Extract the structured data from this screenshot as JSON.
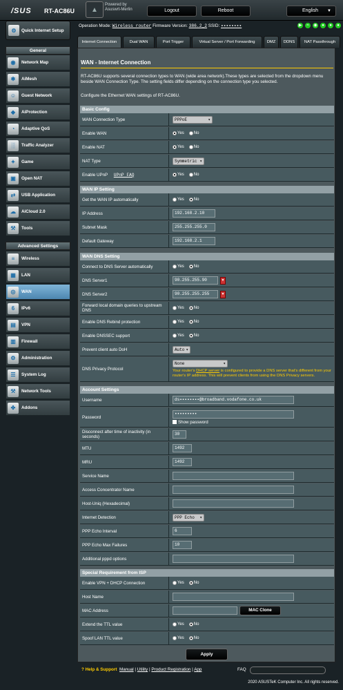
{
  "header": {
    "logo": "/SUS",
    "model": "RT-AC86U",
    "powered_by": "Powered by",
    "powered_name": "Asuswrt-Merlin",
    "logout": "Logout",
    "reboot": "Reboot",
    "language": "English"
  },
  "opbar": {
    "mode_label": "Operation Mode:",
    "mode_value": "Wireless router",
    "fw_label": "Firmware Version:",
    "fw_value": "386.2_2",
    "ssid_label": "SSID:",
    "ssid_value": "▪▪▪▪▪▪▪▪"
  },
  "sidebar": {
    "qis": "Quick Internet Setup",
    "general_header": "General",
    "general": [
      {
        "label": "Network Map",
        "icon": "network-map"
      },
      {
        "label": "AiMesh",
        "icon": "aimesh"
      },
      {
        "label": "Guest Network",
        "icon": "guest-network"
      },
      {
        "label": "AiProtection",
        "icon": "shield"
      },
      {
        "label": "Adaptive QoS",
        "icon": "qos-gauge"
      },
      {
        "label": "Traffic Analyzer",
        "icon": "traffic-chart"
      },
      {
        "label": "Game",
        "icon": "gamepad"
      },
      {
        "label": "Open NAT",
        "icon": "open-nat"
      },
      {
        "label": "USB Application",
        "icon": "usb"
      },
      {
        "label": "AiCloud 2.0",
        "icon": "cloud"
      },
      {
        "label": "Tools",
        "icon": "wrench"
      }
    ],
    "advanced_header": "Advanced Settings",
    "advanced": [
      {
        "label": "Wireless",
        "icon": "wifi"
      },
      {
        "label": "LAN",
        "icon": "lan"
      },
      {
        "label": "WAN",
        "icon": "globe"
      },
      {
        "label": "IPv6",
        "icon": "ipv6"
      },
      {
        "label": "VPN",
        "icon": "vpn"
      },
      {
        "label": "Firewall",
        "icon": "firewall"
      },
      {
        "label": "Administration",
        "icon": "admin"
      },
      {
        "label": "System Log",
        "icon": "log"
      },
      {
        "label": "Network Tools",
        "icon": "network-tools"
      },
      {
        "label": "Addons",
        "icon": "puzzle"
      }
    ]
  },
  "tabs": [
    "Internet Connection",
    "Dual WAN",
    "Port Trigger",
    "Virtual Server / Port Forwarding",
    "DMZ",
    "DDNS",
    "NAT Passthrough"
  ],
  "page": {
    "title": "WAN - Internet Connection",
    "desc": "RT-AC86U supports several connection types to WAN (wide area network).These types are selected from the dropdown menu beside WAN Connection Type. The setting fields differ depending on the connection type you selected.",
    "desc2": "Configure the Ethernet WAN settings of RT-AC86U."
  },
  "basic": {
    "header": "Basic Config",
    "wan_type_label": "WAN Connection Type",
    "wan_type": "PPPoE",
    "enable_wan": "Enable WAN",
    "enable_nat": "Enable NAT",
    "nat_type_label": "NAT Type",
    "nat_type": "Symmetric",
    "upnp_label": "Enable UPnP",
    "upnp_faq": "UPnP FAQ",
    "yes": "Yes",
    "no": "No"
  },
  "wanip": {
    "header": "WAN IP Setting",
    "auto_label": "Get the WAN IP automatically",
    "ip_label": "IP Address",
    "ip": "192.168.2.10",
    "mask_label": "Subnet Mask",
    "mask": "255.255.255.0",
    "gw_label": "Default Gateway",
    "gw": "192.168.2.1"
  },
  "dns": {
    "header": "WAN DNS Setting",
    "auto_label": "Connect to DNS Server automatically",
    "dns1_label": "DNS Server1",
    "dns1": "90.255.255.90",
    "dns2_label": "DNS Server2",
    "dns2": "90.255.255.255",
    "forward_label": "Forward local domain queries to upstream DNS",
    "rebind_label": "Enable DNS Rebind protection",
    "dnssec_label": "Enable DNSSEC support",
    "doh_label": "Prevent client auto DoH",
    "doh": "Auto",
    "privacy_label": "DNS Privacy Protocol",
    "privacy": "None",
    "warn_pre": "Your router's ",
    "warn_link": "DHCP server",
    "warn_post": " is configured to provide a DNS server that's different from your router's IP address. This will prevent clients from using the DNS Privacy servers."
  },
  "account": {
    "header": "Account Settings",
    "user_label": "Username",
    "user": "ds▪▪▪▪▪▪▪▪@broadband.vodafone.co.uk",
    "pass_label": "Password",
    "pass": "•••••••••",
    "show_pass": "Show password",
    "idle_label": "Disconnect after time of inactivity (in seconds)",
    "idle": "30",
    "mtu_label": "MTU",
    "mtu": "1492",
    "mru_label": "MRU",
    "mru": "1492",
    "service_label": "Service Name",
    "ac_label": "Access Concentrator Name",
    "hostuniq_label": "Host-Uniq (Hexadecimal)",
    "detect_label": "Internet Detection",
    "detect": "PPP Echo",
    "echo_label": "PPP Echo Interval",
    "echo": "6",
    "fail_label": "PPP Echo Max Failures",
    "fail": "10",
    "pppd_label": "Additional pppd options"
  },
  "isp": {
    "header": "Special Requirement from ISP",
    "vpn_label": "Enable VPN + DHCP Connection",
    "host_label": "Host Name",
    "mac_label": "MAC Address",
    "mac_clone": "MAC Clone",
    "ttl_label": "Extend the TTL value",
    "spoof_label": "Spoof LAN TTL value"
  },
  "apply": "Apply",
  "footer": {
    "help": "Help & Support",
    "manual": "Manual",
    "utility": "Utility",
    "product_reg": "Product Registration",
    "app": "App",
    "faq": "FAQ",
    "copyright": "2020 ASUSTeK Computer Inc. All rights reserved."
  }
}
